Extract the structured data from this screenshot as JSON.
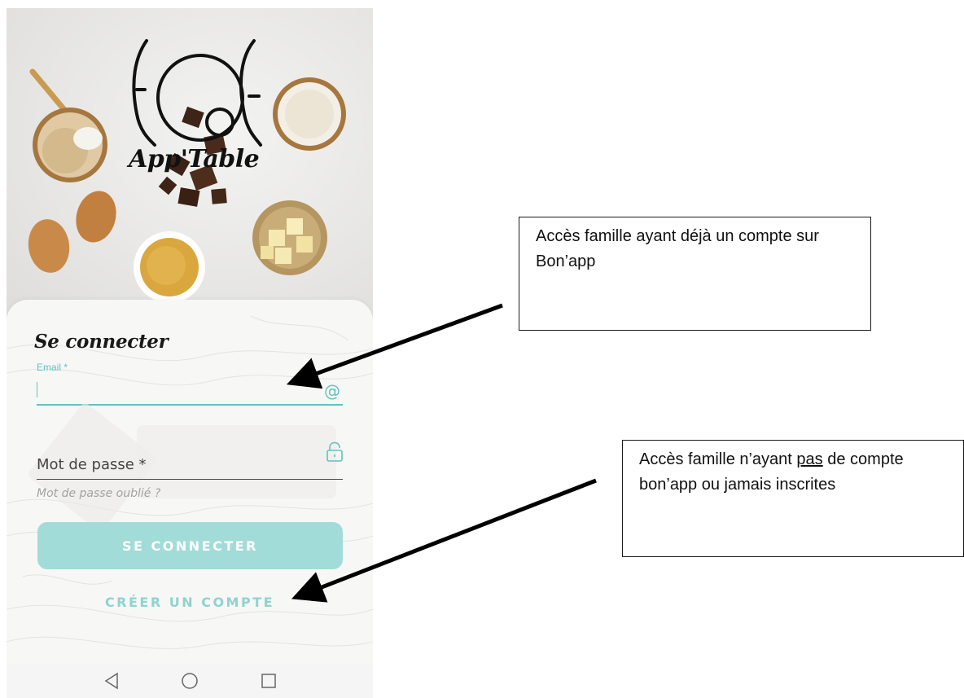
{
  "app": {
    "logo_text": "App'Table"
  },
  "login_card": {
    "title": "Se connecter",
    "email_label": "Email *",
    "email_value": "",
    "email_icon": "at-icon",
    "password_placeholder": "Mot de passe *",
    "password_icon": "lock-icon",
    "forgot_link": "Mot de passe oublié ?",
    "login_button": "SE CONNECTER",
    "create_account": "CRÉER UN COMPTE"
  },
  "navbar": {
    "back_icon": "triangle-back-icon",
    "home_icon": "circle-home-icon",
    "recents_icon": "square-recents-icon"
  },
  "annotations": {
    "note1": "Accès famille ayant déjà un compte sur Bon’app",
    "note2_part1": "Accès famille n’ayant ",
    "note2_underlined": "pas",
    "note2_part2": " de compte bon’app ou jamais inscrites"
  },
  "colors": {
    "accent": "#5fc4bd",
    "button_bg": "#a2dcd8",
    "text_dark": "#1a1a1a"
  }
}
